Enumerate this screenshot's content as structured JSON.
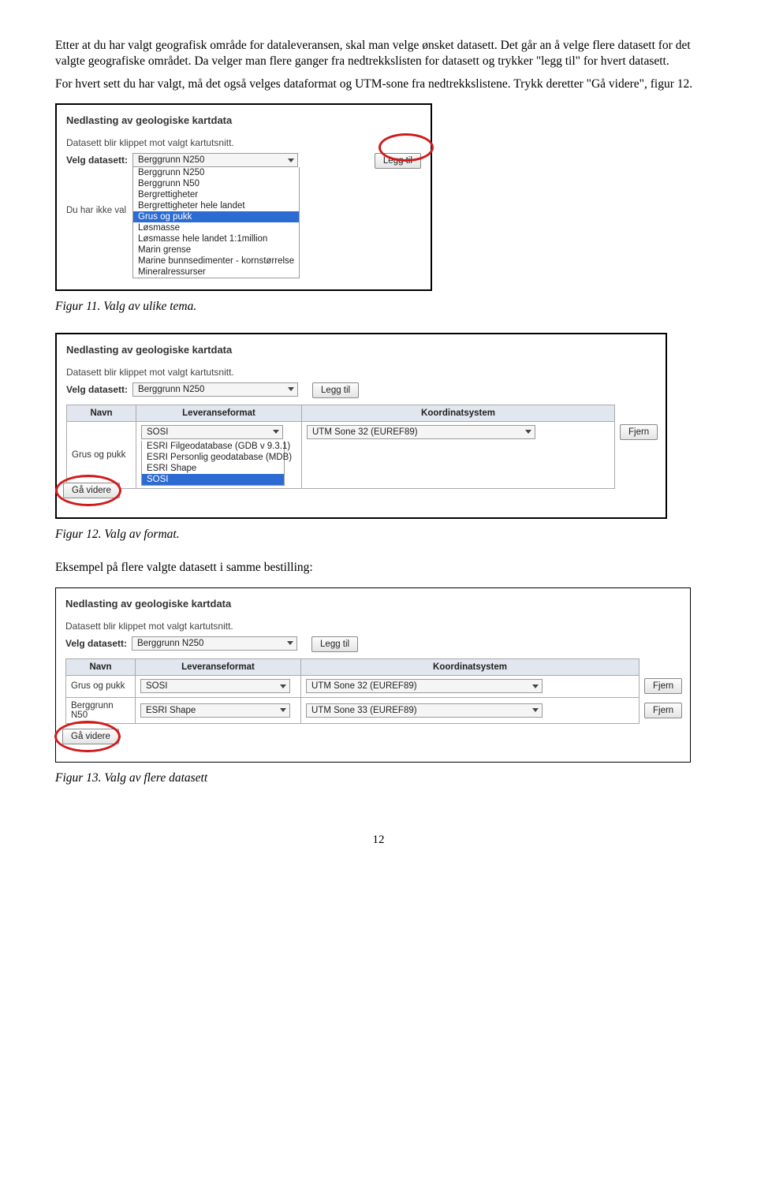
{
  "para1": "Etter at du har valgt geografisk område for dataleveransen, skal man velge ønsket datasett. Det går an å velge flere datasett for det valgte geografiske området. Da velger man flere ganger fra nedtrekkslisten for datasett og trykker \"legg til\" for hvert datasett.",
  "para2": "For hvert sett du har valgt, må det også velges dataformat og UTM-sone fra nedtrekkslistene. Trykk deretter \"Gå videre\", figur 12.",
  "cap11": "Figur 11. Valg av ulike tema.",
  "cap12": "Figur 12. Valg av format.",
  "para3": "Eksempel på flere valgte datasett i samme bestilling:",
  "cap13": "Figur 13. Valg av flere datasett",
  "pageNumber": "12",
  "panel": {
    "heading": "Nedlasting av geologiske kartdata",
    "sub": "Datasett blir klippet mot valgt kartutsnitt.",
    "selectLabel": "Velg datasett:",
    "selectValue": "Berggrunn N250",
    "addBtn": "Legg til",
    "noChoice": "Du har ikke val",
    "goBtn": "Gå videre"
  },
  "dropdownOptions": [
    "Berggrunn N250",
    "Berggrunn N50",
    "Bergrettigheter",
    "Bergrettigheter hele landet",
    "Grus og pukk",
    "Løsmasse",
    "Løsmasse hele landet 1:1million",
    "Marin grense",
    "Marine bunnsedimenter - kornstørrelse",
    "Mineralressurser"
  ],
  "dropdownSelectedIndex": 4,
  "tableHeaders": {
    "navn": "Navn",
    "lev": "Leveranseformat",
    "koord": "Koordinatsystem",
    "fjern": "Fjern"
  },
  "fig12": {
    "rowNavn": "Grus og pukk",
    "levSel": "SOSI",
    "levOptions": [
      "ESRI Filgeodatabase (GDB v 9.3.1)",
      "ESRI Personlig geodatabase (MDB)",
      "ESRI Shape",
      "SOSI"
    ],
    "levHighlightIndex": 3,
    "koordSel": "UTM Sone 32 (EUREF89)"
  },
  "fig13": {
    "rows": [
      {
        "navn": "Grus og pukk",
        "lev": "SOSI",
        "koord": "UTM Sone 32 (EUREF89)"
      },
      {
        "navn": "Berggrunn N50",
        "lev": "ESRI Shape",
        "koord": "UTM Sone 33 (EUREF89)"
      }
    ]
  }
}
